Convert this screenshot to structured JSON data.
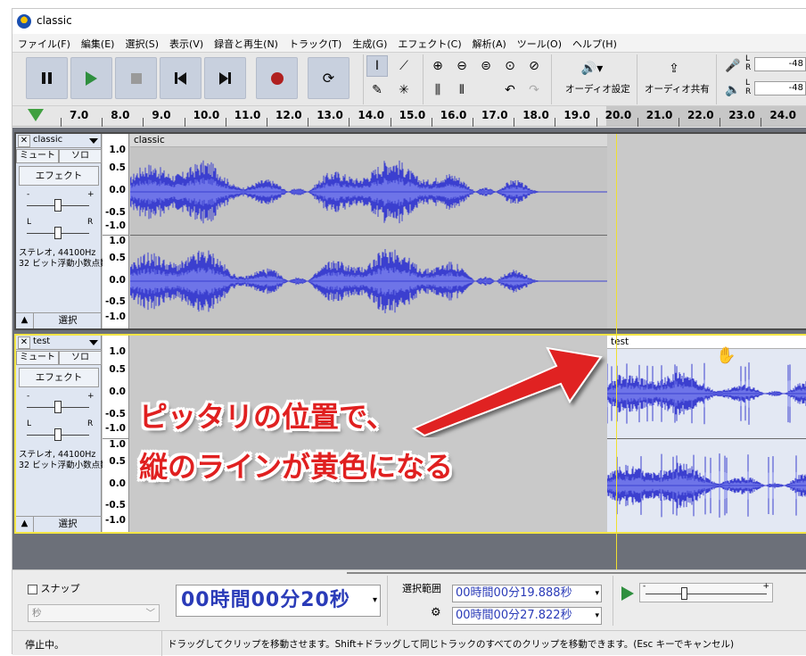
{
  "window": {
    "title": "classic"
  },
  "menu": [
    "ファイル(F)",
    "編集(E)",
    "選択(S)",
    "表示(V)",
    "録音と再生(N)",
    "トラック(T)",
    "生成(G)",
    "エフェクト(C)",
    "解析(A)",
    "ツール(O)",
    "ヘルプ(H)"
  ],
  "toolbar": {
    "audio_setup_label": "オーディオ設定",
    "share_audio_label": "オーディオ共有",
    "meter_value_1": "-48",
    "meter_value_2": "-48",
    "meter_l": "L",
    "meter_r": "R"
  },
  "ruler": {
    "ticks": [
      "7.0",
      "8.0",
      "9.0",
      "10.0",
      "11.0",
      "12.0",
      "13.0",
      "14.0",
      "15.0",
      "16.0",
      "17.0",
      "18.0",
      "19.0",
      "20.0",
      "21.0",
      "22.0",
      "23.0",
      "24.0"
    ]
  },
  "tracks": [
    {
      "name": "classic",
      "mute_label": "ミュート",
      "solo_label": "ソロ",
      "effect_label": "エフェクト",
      "info_line1": "ステレオ, 44100Hz",
      "info_line2": "32 ビット浮動小数点数",
      "select_label": "選択",
      "clip_name": "classic",
      "scale": [
        "1.0",
        "0.5",
        "0.0",
        "-0.5",
        "-1.0"
      ]
    },
    {
      "name": "test",
      "mute_label": "ミュート",
      "solo_label": "ソロ",
      "effect_label": "エフェクト",
      "info_line1": "ステレオ, 44100Hz",
      "info_line2": "32 ビット浮動小数点数",
      "select_label": "選択",
      "clip_name": "test",
      "scale": [
        "1.0",
        "0.5",
        "0.0",
        "-0.5",
        "-1.0"
      ]
    }
  ],
  "slider_marks": {
    "minus": "-",
    "plus": "+",
    "left": "L",
    "right": "R"
  },
  "callout": {
    "line1": "ピッタリの位置で、",
    "line2": "縦のラインが黄色になる"
  },
  "bottom": {
    "snap_label": "スナップ",
    "snap_unit": "秒",
    "time_main": "00時間00分20秒",
    "selection_label": "選択範囲",
    "sel_start": "00時間00分19.888秒",
    "sel_end": "00時間00分27.822秒"
  },
  "status": {
    "left": "停止中。",
    "message": "ドラッグしてクリップを移動させます。Shift+ドラッグして同じトラックのすべてのクリップを移動できます。(Esc キーでキャンセル)"
  },
  "colors": {
    "waveform": "#3b3fcf",
    "waveform_rms": "#6e74e8",
    "selected_border": "#f3e545",
    "callout": "#e02020"
  }
}
